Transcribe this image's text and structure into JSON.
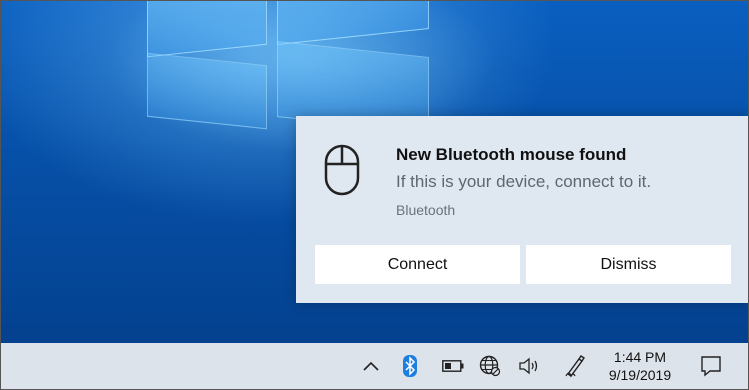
{
  "toast": {
    "title": "New Bluetooth mouse found",
    "body": "If this is your device, connect to it.",
    "source": "Bluetooth",
    "icon": "mouse-icon",
    "buttons": {
      "connect": "Connect",
      "dismiss": "Dismiss"
    }
  },
  "taskbar": {
    "tray_icons": [
      "chevron-up-icon",
      "bluetooth-icon",
      "battery-icon",
      "network-globe-icon",
      "volume-icon",
      "pen-icon"
    ],
    "clock": {
      "time": "1:44 PM",
      "date": "9/19/2019"
    },
    "action_center_icon": "notification-icon"
  },
  "colors": {
    "wallpaper": "#0650a8",
    "toast_background": "#dfe7f1",
    "taskbar_background": "#dde3ea",
    "bluetooth_accent": "#1f7fe0"
  }
}
